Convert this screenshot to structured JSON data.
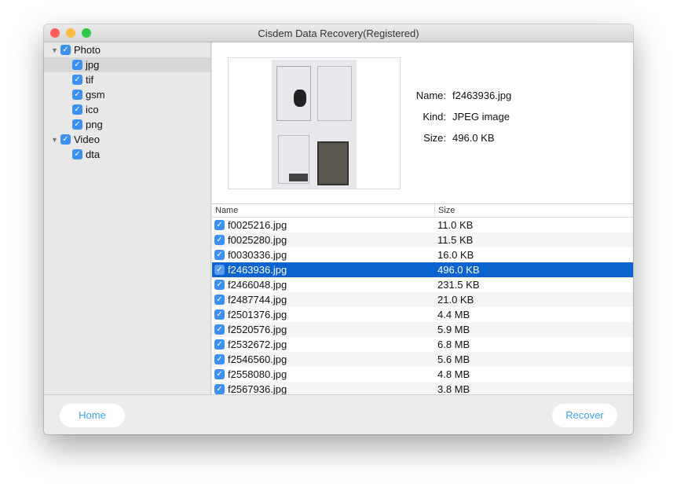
{
  "window": {
    "title": "Cisdem Data Recovery(Registered)"
  },
  "sidebar": {
    "groups": [
      {
        "label": "Photo",
        "items": [
          "jpg",
          "tif",
          "gsm",
          "ico",
          "png"
        ]
      },
      {
        "label": "Video",
        "items": [
          "dta"
        ]
      }
    ]
  },
  "preview": {
    "name_label": "Name:",
    "name": "f2463936.jpg",
    "kind_label": "Kind:",
    "kind": "JPEG image",
    "size_label": "Size:",
    "size": "496.0 KB"
  },
  "table": {
    "headers": [
      "Name",
      "Size"
    ],
    "rows": [
      {
        "name": "f0025216.jpg",
        "size": "11.0 KB"
      },
      {
        "name": "f0025280.jpg",
        "size": "11.5 KB"
      },
      {
        "name": "f0030336.jpg",
        "size": "16.0 KB"
      },
      {
        "name": "f2463936.jpg",
        "size": "496.0 KB"
      },
      {
        "name": "f2466048.jpg",
        "size": "231.5 KB"
      },
      {
        "name": "f2487744.jpg",
        "size": "21.0 KB"
      },
      {
        "name": "f2501376.jpg",
        "size": "4.4 MB"
      },
      {
        "name": "f2520576.jpg",
        "size": "5.9 MB"
      },
      {
        "name": "f2532672.jpg",
        "size": "6.8 MB"
      },
      {
        "name": "f2546560.jpg",
        "size": "5.6 MB"
      },
      {
        "name": "f2558080.jpg",
        "size": "4.8 MB"
      },
      {
        "name": "f2567936.jpg",
        "size": "3.8 MB"
      }
    ],
    "selected_index": 3
  },
  "footer": {
    "home": "Home",
    "recover": "Recover"
  }
}
